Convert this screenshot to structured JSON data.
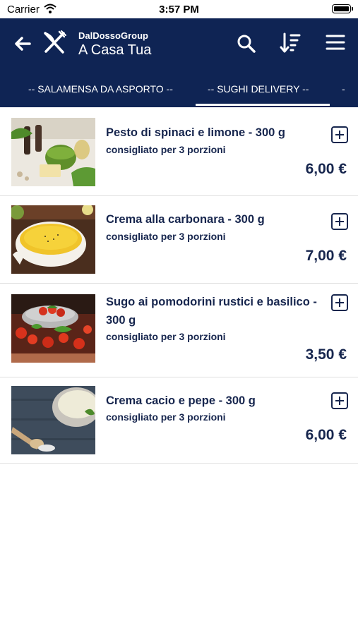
{
  "status_bar": {
    "carrier": "Carrier",
    "time": "3:57 PM",
    "wifi_icon": "wifi-icon",
    "battery_icon": "battery-icon"
  },
  "header": {
    "group": "DalDossoGroup",
    "title": "A Casa Tua",
    "background_color": "#0f2454",
    "icons": [
      "back-arrow-icon",
      "fork-knife-icon",
      "search-icon",
      "sort-icon",
      "menu-icon"
    ]
  },
  "tabs": [
    {
      "label": "-- SALAMENSA DA ASPORTO --",
      "selected": false
    },
    {
      "label": "-- SUGHI DELIVERY --",
      "selected": true
    },
    {
      "label": "-",
      "selected": false
    }
  ],
  "products": [
    {
      "name": "Pesto di spinaci e limone - 300 g",
      "description": "consigliato per 3 porzioni",
      "price": "6,00 €",
      "image": "pesto-image"
    },
    {
      "name": "Crema alla carbonara - 300 g",
      "description": "consigliato per 3 porzioni",
      "price": "7,00 €",
      "image": "carbonara-image"
    },
    {
      "name": "Sugo ai pomodorini rustici e basilico - 300 g",
      "description": "consigliato per 3 porzioni",
      "price": "3,50 €",
      "image": "tomato-sauce-image"
    },
    {
      "name": "Crema cacio e pepe - 300 g",
      "description": "consigliato per 3 porzioni",
      "price": "6,00 €",
      "image": "cacio-pepe-image"
    }
  ]
}
